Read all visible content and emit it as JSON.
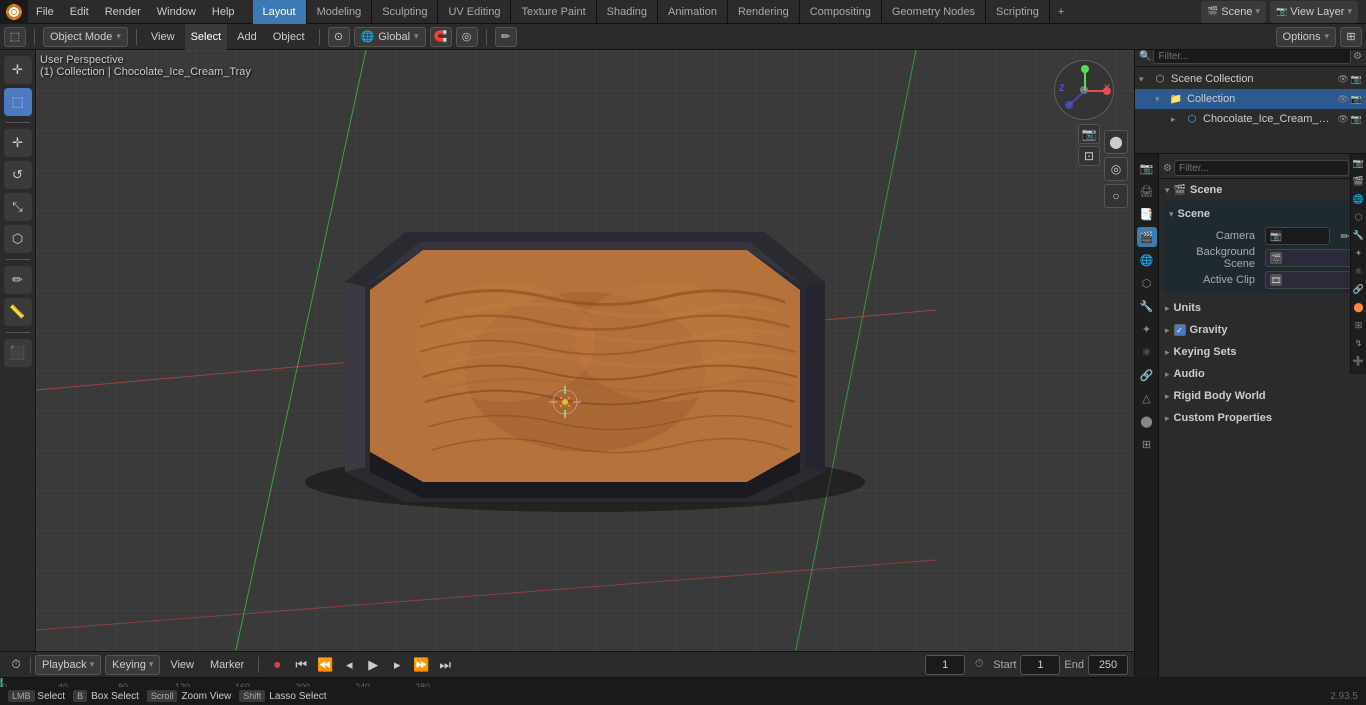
{
  "app": {
    "title": "Blender",
    "version": "2.93.5"
  },
  "top_menu": {
    "logo": "⬡",
    "items": [
      "File",
      "Edit",
      "Render",
      "Window",
      "Help"
    ],
    "active_workspace": "Layout",
    "workspaces": [
      "Layout",
      "Modeling",
      "Sculpting",
      "UV Editing",
      "Texture Paint",
      "Shading",
      "Animation",
      "Rendering",
      "Compositing",
      "Geometry Nodes",
      "Scripting"
    ],
    "scene_label": "Scene",
    "view_layer_label": "View Layer"
  },
  "header": {
    "mode_label": "Object Mode",
    "view_label": "View",
    "select_label": "Select",
    "add_label": "Add",
    "object_label": "Object",
    "transform_label": "Global",
    "options_label": "Options"
  },
  "viewport": {
    "info_line1": "User Perspective",
    "info_line2": "(1) Collection | Chocolate_Ice_Cream_Tray"
  },
  "outliner": {
    "title": "Scene Collection",
    "search_placeholder": "Filter...",
    "items": [
      {
        "label": "Collection",
        "level": 0,
        "expanded": true,
        "icon": "📁"
      },
      {
        "label": "Chocolate_Ice_Cream_Tr...",
        "level": 1,
        "expanded": false,
        "icon": "🔷"
      }
    ]
  },
  "properties": {
    "active_tab": "scene",
    "tabs": [
      "render",
      "output",
      "view_layer",
      "scene",
      "world",
      "object",
      "modifier",
      "particles",
      "physics",
      "constraints",
      "object_data",
      "material",
      "texture"
    ],
    "scene_section": {
      "label": "Scene",
      "camera_label": "Camera",
      "camera_value": "",
      "background_scene_label": "Background Scene",
      "active_clip_label": "Active Clip",
      "scene_section_label": "Scene"
    },
    "units_label": "Units",
    "gravity_label": "Gravity",
    "gravity_checked": true,
    "keying_sets_label": "Keying Sets",
    "audio_label": "Audio",
    "rigid_body_world_label": "Rigid Body World",
    "custom_properties_label": "Custom Properties"
  },
  "timeline": {
    "playback_label": "Playback",
    "keying_label": "Keying",
    "view_label": "View",
    "marker_label": "Marker",
    "play_icon": "▶",
    "frame_current": "1",
    "start_label": "Start",
    "start_value": "1",
    "end_label": "End",
    "end_value": "250",
    "frame_markers": [
      "0",
      "40",
      "80",
      "120",
      "160",
      "200",
      "240",
      "280"
    ],
    "ruler_numbers": [
      0,
      40,
      80,
      120,
      160,
      200,
      240,
      280
    ]
  },
  "status_bar": {
    "select_label": "Select",
    "box_select_label": "Box Select",
    "zoom_view_label": "Zoom View",
    "lasso_select_label": "Lasso Select",
    "version": "2.93.5"
  },
  "colors": {
    "accent_blue": "#3d7ab5",
    "bg_dark": "#1a1a1a",
    "bg_medium": "#2b2b2b",
    "bg_light": "#3a3a3a",
    "axis_x": "#cc3333",
    "axis_y": "#33cc33",
    "axis_z": "#3333cc",
    "selected": "#2d5a8e"
  }
}
